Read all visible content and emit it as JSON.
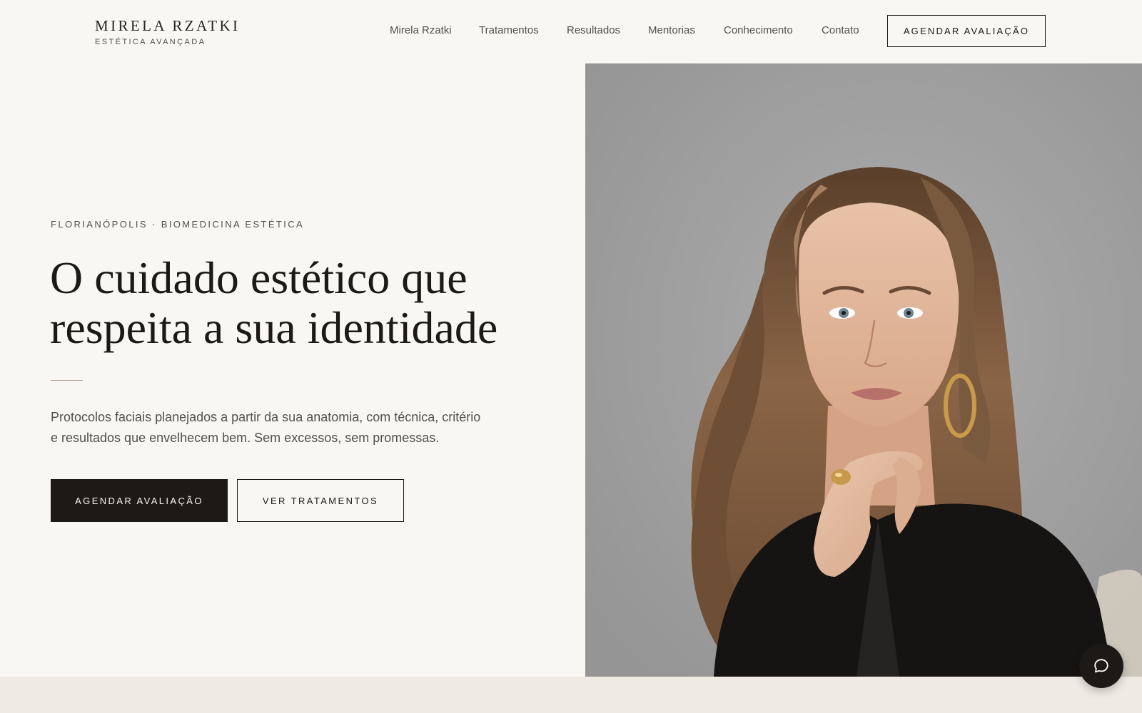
{
  "brand": {
    "name": "MIRELA RZATKI",
    "tagline": "ESTÉTICA AVANÇADA"
  },
  "nav": {
    "items": [
      {
        "label": "Mirela Rzatki"
      },
      {
        "label": "Tratamentos"
      },
      {
        "label": "Resultados"
      },
      {
        "label": "Mentorias"
      },
      {
        "label": "Conhecimento"
      },
      {
        "label": "Contato"
      }
    ],
    "cta_label": "AGENDAR AVALIAÇÃO"
  },
  "hero": {
    "eyebrow": "FLORIANÓPOLIS · BIOMEDICINA ESTÉTICA",
    "headline_line1": "O cuidado estético que",
    "headline_line2": "respeita a sua identidade",
    "lede_line1": "Protocolos faciais planejados a partir da sua anatomia, com técnica, critério",
    "lede_line2": "e resultados que envelhecem bem. Sem excessos, sem promessas.",
    "primary_cta": "AGENDAR AVALIAÇÃO",
    "secondary_cta": "VER TRATAMENTOS"
  },
  "chat": {
    "icon": "chat-bubble-icon"
  },
  "colors": {
    "background": "#f8f7f3",
    "ink": "#1c1917",
    "muted_text": "#55504c",
    "accent_divider": "#b5a18b",
    "band": "#efebe4",
    "photo_backdrop": "#a0a0a0"
  }
}
